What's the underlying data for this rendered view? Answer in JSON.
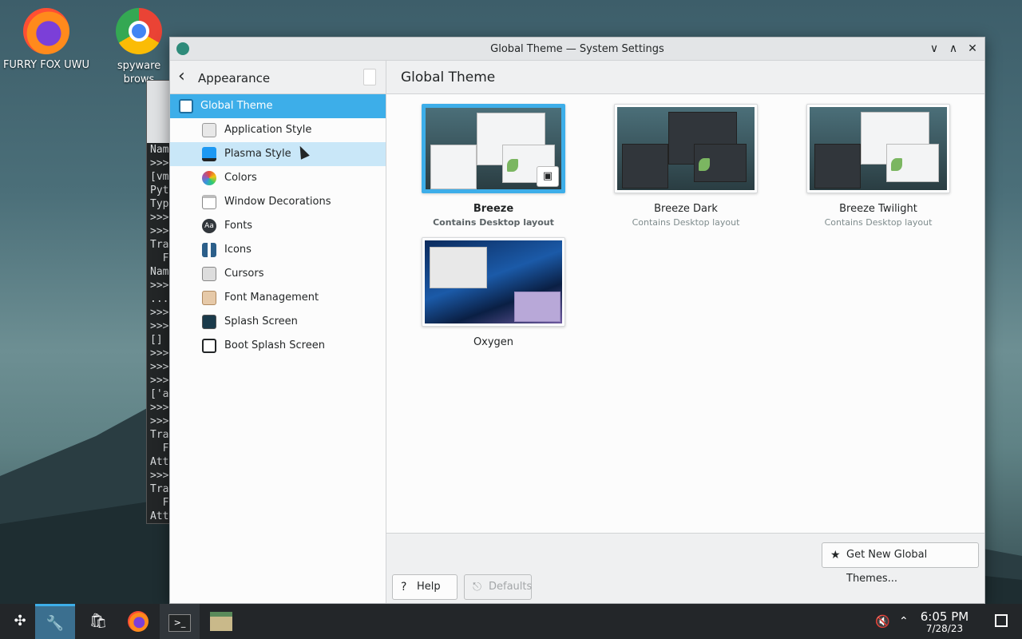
{
  "desktop": {
    "icons": [
      {
        "label": "FURRY FOX UWU",
        "icon": "firefox-icon"
      },
      {
        "label": "spyware brows",
        "icon": "chrome-icon"
      }
    ]
  },
  "terminal": {
    "lines": [
      "Nam",
      ">>>",
      "[vm",
      "Pyt",
      "Typ",
      ">>>",
      ">>>",
      "Tra",
      "  F",
      "Nam",
      ">>>",
      "...",
      ">>>",
      ">>>",
      "[]",
      ">>>",
      ">>>",
      ">>>",
      "['a",
      ">>>",
      ">>>",
      "Tra",
      "  F",
      "Att",
      ">>>",
      "Tra",
      "  F",
      "Att",
      ">>>"
    ]
  },
  "window": {
    "title": "Global Theme — System Settings",
    "controls": {
      "minimize": "∨",
      "maximize": "∧",
      "close": "✕"
    },
    "sidebar": {
      "header": "Appearance",
      "items": [
        {
          "label": "Global Theme",
          "icon": "global-theme-icon"
        },
        {
          "label": "Application Style",
          "icon": "application-style-icon"
        },
        {
          "label": "Plasma Style",
          "icon": "plasma-style-icon"
        },
        {
          "label": "Colors",
          "icon": "colors-icon"
        },
        {
          "label": "Window Decorations",
          "icon": "window-decorations-icon"
        },
        {
          "label": "Fonts",
          "icon": "fonts-icon"
        },
        {
          "label": "Icons",
          "icon": "icons-icon"
        },
        {
          "label": "Cursors",
          "icon": "cursors-icon"
        },
        {
          "label": "Font Management",
          "icon": "font-management-icon"
        },
        {
          "label": "Splash Screen",
          "icon": "splash-screen-icon"
        },
        {
          "label": "Boot Splash Screen",
          "icon": "boot-splash-icon"
        }
      ]
    },
    "main": {
      "heading": "Global Theme",
      "themes": [
        {
          "name": "Breeze",
          "subtitle": "Contains Desktop layout",
          "selected": true
        },
        {
          "name": "Breeze Dark",
          "subtitle": "Contains Desktop layout",
          "selected": false
        },
        {
          "name": "Breeze Twilight",
          "subtitle": "Contains Desktop layout",
          "selected": false
        },
        {
          "name": "Oxygen",
          "subtitle": "",
          "selected": false
        }
      ],
      "get_new_label": "Get New Global Themes...",
      "help_label": "Help",
      "defaults_label": "Defaults"
    }
  },
  "taskbar": {
    "clock_time": "6:05 PM",
    "clock_date": "7/28/23",
    "accent": "#3daee9"
  }
}
